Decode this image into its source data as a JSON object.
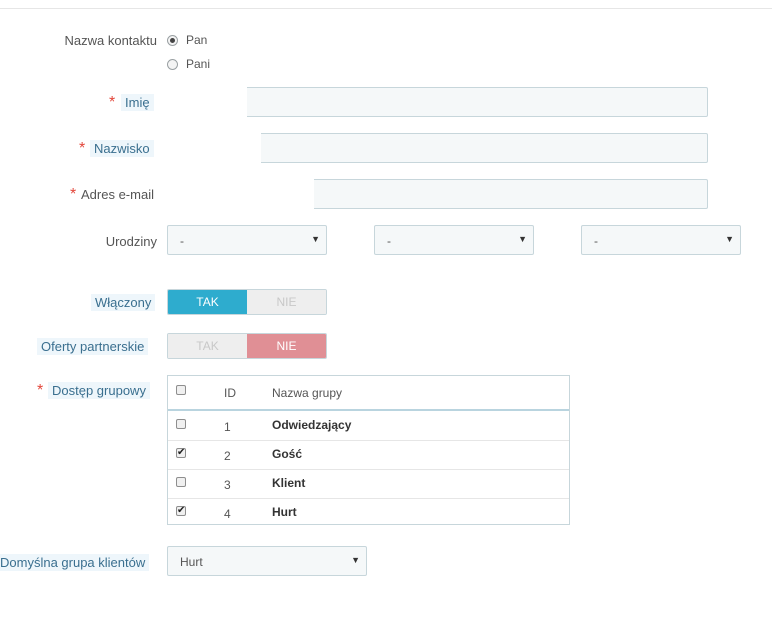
{
  "form": {
    "contact_name_label": "Nazwa kontaktu",
    "radio_options": [
      {
        "label": "Pan",
        "checked": true
      },
      {
        "label": "Pani",
        "checked": false
      }
    ],
    "first_name_label": "Imię",
    "last_name_label": "Nazwisko",
    "email_label": "Adres e-mail",
    "required_marker": "*",
    "birthday_label": "Urodziny",
    "birthday_selects": [
      "-",
      "-",
      "-"
    ],
    "enabled_label": "Włączony",
    "partner_offers_label": "Oferty partnerskie",
    "switch_yes": "TAK",
    "switch_no": "NIE",
    "enabled_value": "TAK",
    "partner_offers_value": "NIE",
    "group_access_label": "Dostęp grupowy",
    "default_group_label": "Domyślna grupa klientów",
    "default_group_value": "Hurt"
  },
  "groups_table": {
    "columns": [
      "ID",
      "Nazwa grupy"
    ],
    "rows": [
      {
        "id": "1",
        "name": "Odwiedzający",
        "checked": false
      },
      {
        "id": "2",
        "name": "Gość",
        "checked": true
      },
      {
        "id": "3",
        "name": "Klient",
        "checked": false
      },
      {
        "id": "4",
        "name": "Hurt",
        "checked": true
      }
    ]
  },
  "icons": {
    "select_arrow": "caret-down-icon",
    "checkmark": "check-icon"
  },
  "colors": {
    "switch_yes_active": "#2eacce",
    "switch_no_active": "#e08f95",
    "required": "#e3463a"
  }
}
